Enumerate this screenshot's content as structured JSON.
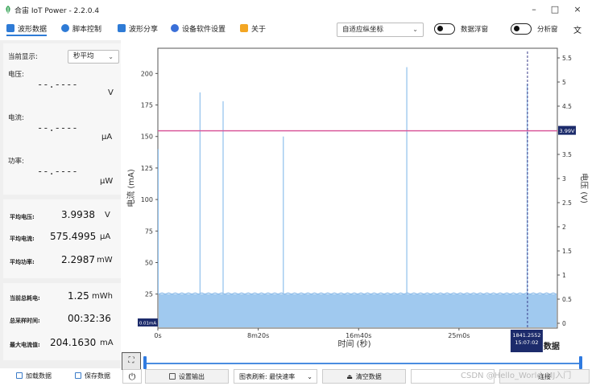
{
  "window": {
    "title": "合宙 IoT Power - 2.2.0.4",
    "min": "–",
    "max": "□",
    "close": "×"
  },
  "toolbar": {
    "tabs": [
      {
        "label": "波形数据",
        "icon": "waveform-icon",
        "color": "#2e7bd6"
      },
      {
        "label": "脚本控制",
        "icon": "script-icon",
        "color": "#2e7bd6"
      },
      {
        "label": "波形分享",
        "icon": "share-icon",
        "color": "#2e7bd6"
      },
      {
        "label": "设备软件设置",
        "icon": "settings-icon",
        "color": "#3a6fd8"
      },
      {
        "label": "关于",
        "icon": "info-icon",
        "color": "#f3a623"
      }
    ],
    "coord_select": "自适应纵坐标",
    "data_float_label": "数据浮窗",
    "analysis_label": "分析窗",
    "lang_glyph": "文"
  },
  "sidebar": {
    "display_label": "当前显示:",
    "display_value": "秒平均",
    "voltage_label": "电压:",
    "voltage_value": "--.----",
    "voltage_unit": "V",
    "current_label": "电流:",
    "current_value": "--.----",
    "current_unit": "μA",
    "power_label": "功率:",
    "power_value": "--.----",
    "power_unit": "μW",
    "avg_voltage_label": "平均电压:",
    "avg_voltage_value": "3.9938",
    "avg_voltage_unit": "V",
    "avg_current_label": "平均电流:",
    "avg_current_value": "575.4995",
    "avg_current_unit": "μA",
    "avg_power_label": "平均功率:",
    "avg_power_value": "2.2987",
    "avg_power_unit": "mW",
    "total_energy_label": "当前总耗电:",
    "total_energy_value": "1.25",
    "total_energy_unit": "mWh",
    "sample_time_label": "总采样时间:",
    "sample_time_value": "00:32:36",
    "max_current_label": "最大电流值:",
    "max_current_value": "204.1630",
    "max_current_unit": "mA"
  },
  "bottom": {
    "load_label": "加载数据",
    "save_label": "保存数据",
    "power_glyph": "⏻",
    "output_label": "设置输出",
    "refresh_label": "图表刷新: 最快速率",
    "clear_label": "清空数据",
    "connect_label": "连接",
    "watermark": "CSDN @Hello_World_MJ入门"
  },
  "chart_data": {
    "type": "line",
    "xlabel": "时间 (秒)",
    "ylabel_left": "电流 (mA)",
    "ylabel_right": "电压 (V)",
    "x_ticks": [
      "0s",
      "8m20s",
      "16m40s",
      "25m0s"
    ],
    "x_tick_values": [
      0,
      500,
      1000,
      1500
    ],
    "xlim": [
      0,
      1990
    ],
    "y_left_ticks": [
      25,
      50,
      75,
      100,
      125,
      150,
      175,
      200
    ],
    "ylim_left": [
      -2,
      220
    ],
    "y_right_ticks": [
      "0",
      "0.5",
      "1",
      "1.5",
      "2",
      "2.5",
      "3",
      "3.5",
      "4.5",
      "5",
      "5.5"
    ],
    "y_right_tick_values": [
      0,
      0.5,
      1,
      1.5,
      2,
      2.5,
      3,
      3.5,
      4.5,
      5,
      5.5
    ],
    "ylim_right": [
      -0.1,
      5.7
    ],
    "baseline_current_ma": 0.58,
    "noise_band_top_ma": 25,
    "current_spikes": [
      {
        "x": 2,
        "y": 140
      },
      {
        "x": 210,
        "y": 185
      },
      {
        "x": 325,
        "y": 178
      },
      {
        "x": 625,
        "y": 150
      },
      {
        "x": 1240,
        "y": 205
      },
      {
        "x": 1840,
        "y": 192
      }
    ],
    "voltage_value": 3.99,
    "voltage_badge": "3.99V",
    "min_badge": "0.01mA",
    "cursor_x": 1841.2552,
    "cursor_label_x": "1841.2552",
    "cursor_label_time": "15:07:02",
    "cursor_label_extra": "数据",
    "series_colors": {
      "current": "#8fc0ec",
      "voltage": "#d95a9c"
    },
    "grid": false
  }
}
